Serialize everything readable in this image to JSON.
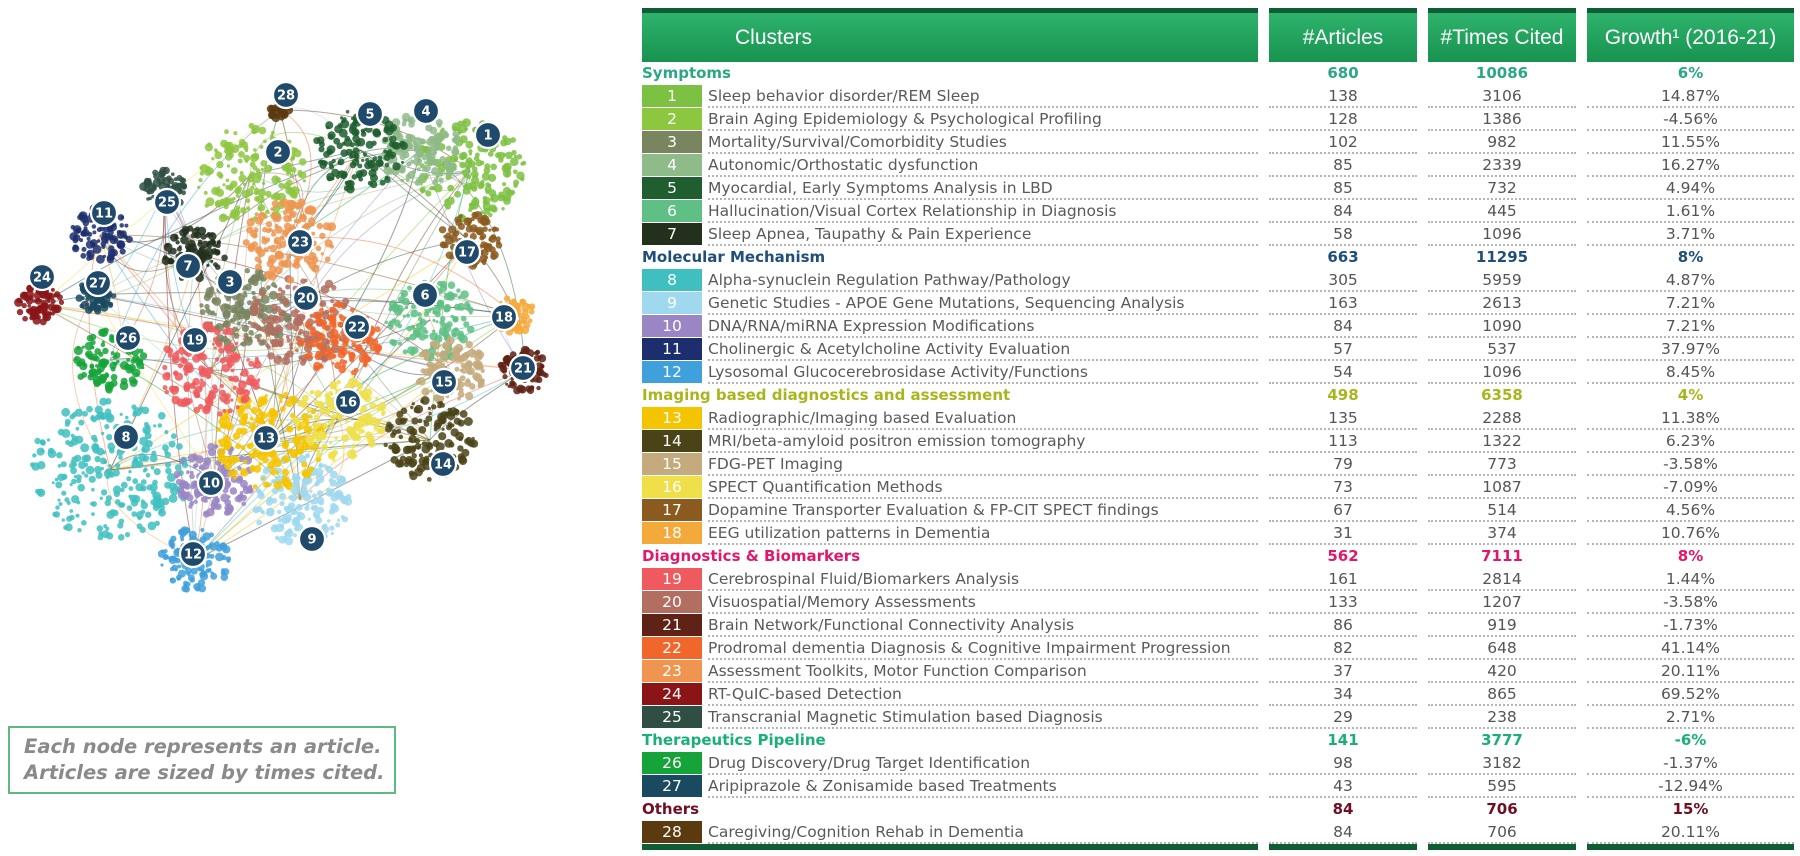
{
  "note": {
    "line1": "Each node represents an article.",
    "line2": "Articles are sized by times cited."
  },
  "table": {
    "header": {
      "clusters": "Clusters",
      "articles": "#Articles",
      "cited": "#Times Cited",
      "growth": "Growth¹ (2016-21)"
    },
    "categories": [
      {
        "name": "Symptoms",
        "articles": "680",
        "cited": "10086",
        "growth": "6%",
        "color": "#2aa784",
        "rows": [
          {
            "id": "1",
            "label": "Sleep behavior disorder/REM Sleep",
            "articles": "138",
            "cited": "3106",
            "growth": "14.87%",
            "color": "#7cc142"
          },
          {
            "id": "2",
            "label": "Brain Aging Epidemiology & Psychological Profiling",
            "articles": "128",
            "cited": "1386",
            "growth": "-4.56%",
            "color": "#8dc63f"
          },
          {
            "id": "3",
            "label": "Mortality/Survival/Comorbidity Studies",
            "articles": "102",
            "cited": "982",
            "growth": "11.55%",
            "color": "#79855f"
          },
          {
            "id": "4",
            "label": "Autonomic/Orthostatic dysfunction",
            "articles": "85",
            "cited": "2339",
            "growth": "16.27%",
            "color": "#8fba8a"
          },
          {
            "id": "5",
            "label": "Myocardial, Early Symptoms Analysis in LBD",
            "articles": "85",
            "cited": "732",
            "growth": "4.94%",
            "color": "#1f5e2e"
          },
          {
            "id": "6",
            "label": "Hallucination/Visual Cortex Relationship in Diagnosis",
            "articles": "84",
            "cited": "445",
            "growth": "1.61%",
            "color": "#5fbf84"
          },
          {
            "id": "7",
            "label": "Sleep Apnea, Taupathy & Pain Experience",
            "articles": "58",
            "cited": "1096",
            "growth": "3.71%",
            "color": "#22301c"
          }
        ]
      },
      {
        "name": "Molecular Mechanism",
        "articles": "663",
        "cited": "11295",
        "growth": "8%",
        "color": "#1f4e79",
        "rows": [
          {
            "id": "8",
            "label": "Alpha-synuclein Regulation Pathway/Pathology",
            "articles": "305",
            "cited": "5959",
            "growth": "4.87%",
            "color": "#3fbfc0"
          },
          {
            "id": "9",
            "label": "Genetic Studies - APOE Gene Mutations, Sequencing Analysis",
            "articles": "163",
            "cited": "2613",
            "growth": "7.21%",
            "color": "#9fd8ef"
          },
          {
            "id": "10",
            "label": "DNA/RNA/miRNA Expression Modifications",
            "articles": "84",
            "cited": "1090",
            "growth": "7.21%",
            "color": "#9a86c4"
          },
          {
            "id": "11",
            "label": "Cholinergic & Acetylcholine Activity Evaluation",
            "articles": "57",
            "cited": "537",
            "growth": "37.97%",
            "color": "#1c2e6e"
          },
          {
            "id": "12",
            "label": "Lysosomal Glucocerebrosidase Activity/Functions",
            "articles": "54",
            "cited": "1096",
            "growth": "8.45%",
            "color": "#3fa0dc"
          }
        ]
      },
      {
        "name": "Imaging based diagnostics and assessment",
        "articles": "498",
        "cited": "6358",
        "growth": "4%",
        "color": "#a8b51c",
        "rows": [
          {
            "id": "13",
            "label": "Radiographic/Imaging based Evaluation",
            "articles": "135",
            "cited": "2288",
            "growth": "11.38%",
            "color": "#f5c400"
          },
          {
            "id": "14",
            "label": "MRI/beta-amyloid positron emission tomography",
            "articles": "113",
            "cited": "1322",
            "growth": "6.23%",
            "color": "#4a4318"
          },
          {
            "id": "15",
            "label": "FDG-PET Imaging",
            "articles": "79",
            "cited": "773",
            "growth": "-3.58%",
            "color": "#c4aa7c"
          },
          {
            "id": "16",
            "label": "SPECT Quantification Methods",
            "articles": "73",
            "cited": "1087",
            "growth": "-7.09%",
            "color": "#efe04a"
          },
          {
            "id": "17",
            "label": "Dopamine Transporter Evaluation & FP-CIT SPECT findings",
            "articles": "67",
            "cited": "514",
            "growth": "4.56%",
            "color": "#8b5a1e"
          },
          {
            "id": "18",
            "label": "EEG utilization patterns in Dementia",
            "articles": "31",
            "cited": "374",
            "growth": "10.76%",
            "color": "#f4a93b"
          }
        ]
      },
      {
        "name": "Diagnostics & Biomarkers",
        "articles": "562",
        "cited": "7111",
        "growth": "8%",
        "color": "#e0186b",
        "rows": [
          {
            "id": "19",
            "label": "Cerebrospinal Fluid/Biomarkers Analysis",
            "articles": "161",
            "cited": "2814",
            "growth": "1.44%",
            "color": "#ef5a5e"
          },
          {
            "id": "20",
            "label": "Visuospatial/Memory Assessments",
            "articles": "133",
            "cited": "1207",
            "growth": "-3.58%",
            "color": "#b26e60"
          },
          {
            "id": "21",
            "label": "Brain Network/Functional Connectivity Analysis",
            "articles": "86",
            "cited": "919",
            "growth": "-1.73%",
            "color": "#5e2316"
          },
          {
            "id": "22",
            "label": "Prodromal dementia Diagnosis & Cognitive Impairment Progression",
            "articles": "82",
            "cited": "648",
            "growth": "41.14%",
            "color": "#f0662b"
          },
          {
            "id": "23",
            "label": "Assessment Toolkits, Motor Function Comparison",
            "articles": "37",
            "cited": "420",
            "growth": "20.11%",
            "color": "#ef9550"
          },
          {
            "id": "24",
            "label": "RT-QuIC-based Detection",
            "articles": "34",
            "cited": "865",
            "growth": "69.52%",
            "color": "#8a1416"
          },
          {
            "id": "25",
            "label": "Transcranial Magnetic Stimulation based Diagnosis",
            "articles": "29",
            "cited": "238",
            "growth": "2.71%",
            "color": "#2f4f43"
          }
        ]
      },
      {
        "name": "Therapeutics Pipeline",
        "articles": "141",
        "cited": "3777",
        "growth": "-6%",
        "color": "#19b078",
        "rows": [
          {
            "id": "26",
            "label": "Drug Discovery/Drug Target Identification",
            "articles": "98",
            "cited": "3182",
            "growth": "-1.37%",
            "color": "#16a33a"
          },
          {
            "id": "27",
            "label": "Aripiprazole & Zonisamide based Treatments",
            "articles": "43",
            "cited": "595",
            "growth": "-12.94%",
            "color": "#1a4a60"
          }
        ]
      },
      {
        "name": "Others",
        "articles": "84",
        "cited": "706",
        "growth": "15%",
        "color": "#6e0f22",
        "rows": [
          {
            "id": "28",
            "label": "Caregiving/Cognition Rehab in Dementia",
            "articles": "84",
            "cited": "706",
            "growth": "20.11%",
            "color": "#5c3a10"
          }
        ]
      }
    ]
  },
  "chart_data": {
    "type": "network",
    "nodes_are": "articles",
    "clusters": [
      "1",
      "2",
      "3",
      "4",
      "5",
      "6",
      "7",
      "8",
      "9",
      "10",
      "11",
      "12",
      "13",
      "14",
      "15",
      "16",
      "17",
      "18",
      "19",
      "20",
      "21",
      "22",
      "23",
      "24",
      "25",
      "26",
      "27",
      "28"
    ]
  }
}
